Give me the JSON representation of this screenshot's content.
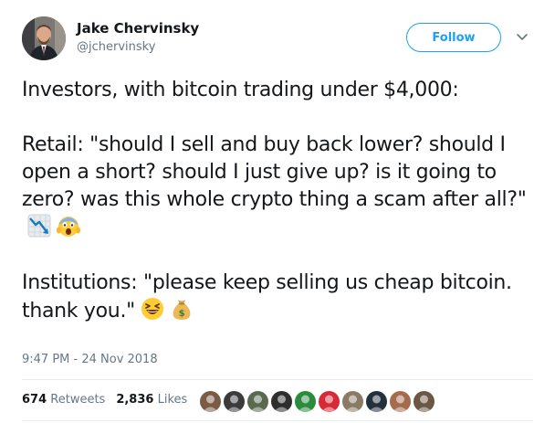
{
  "user": {
    "name": "Jake Chervinsky",
    "handle": "@jchervinsky"
  },
  "follow_label": "Follow",
  "tweet": {
    "line1": "Investors, with bitcoin trading under $4,000:",
    "retail": "Retail: \"should I sell and buy back lower? should I open a short? should I just give up? is it going to zero? was this whole crypto thing a scam after all?\"",
    "institutions": "Institutions: \"please keep selling us cheap bitcoin. thank you.\""
  },
  "timestamp": "9:47 PM - 24 Nov 2018",
  "stats": {
    "retweets_count": "674",
    "retweets_label": "Retweets",
    "likes_count": "2,836",
    "likes_label": "Likes"
  },
  "emojis": [
    "chart-decreasing-icon",
    "screaming-face-icon",
    "laughing-face-icon",
    "money-bag-icon"
  ],
  "colors": {
    "accent": "#1da1f2",
    "muted": "#657786",
    "text": "#14171a"
  },
  "likers": [
    {
      "name": "liker-1",
      "color": "#7a5c46"
    },
    {
      "name": "liker-2",
      "color": "#3b3b3b"
    },
    {
      "name": "liker-3",
      "color": "#5a6a4e"
    },
    {
      "name": "liker-4",
      "color": "#2e2e2e"
    },
    {
      "name": "liker-5",
      "color": "#2a8b3d"
    },
    {
      "name": "liker-6",
      "color": "#d62b36"
    },
    {
      "name": "liker-7",
      "color": "#8a7a64"
    },
    {
      "name": "liker-8",
      "color": "#24313d"
    },
    {
      "name": "liker-9",
      "color": "#a46b4c"
    },
    {
      "name": "liker-10",
      "color": "#6b5844"
    }
  ]
}
